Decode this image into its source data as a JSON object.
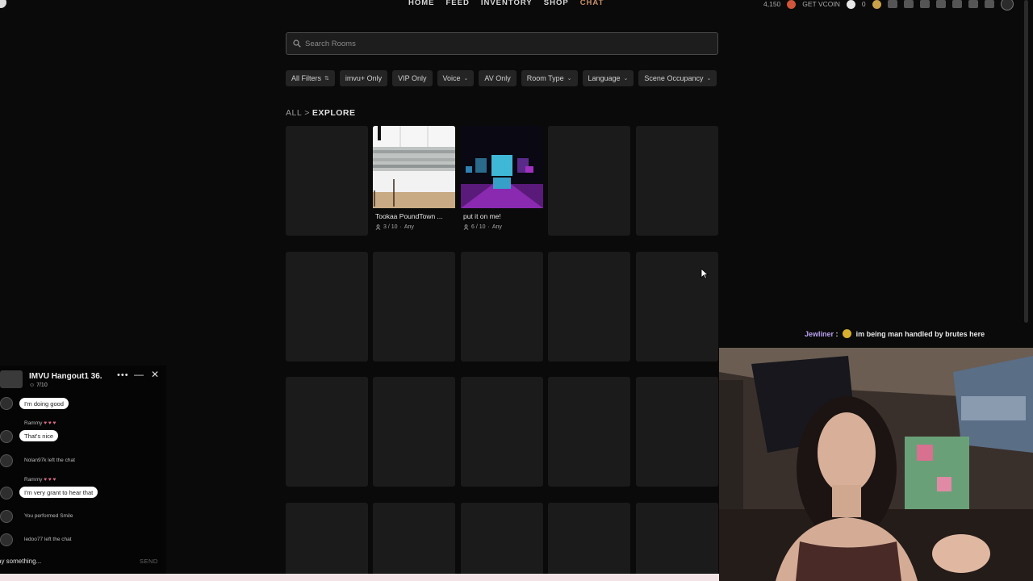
{
  "nav": {
    "links": [
      "HOME",
      "FEED",
      "INVENTORY",
      "SHOP",
      "CHAT"
    ],
    "active": "CHAT",
    "credits": "4,150",
    "get_vcoin": "GET VCOIN",
    "vcoin_balance": "0"
  },
  "search": {
    "placeholder": "Search Rooms"
  },
  "filters": [
    {
      "label": "All Filters",
      "suffix": "⇅"
    },
    {
      "label": "imvu+ Only",
      "suffix": ""
    },
    {
      "label": "VIP Only",
      "suffix": ""
    },
    {
      "label": "Voice",
      "suffix": "⌄"
    },
    {
      "label": "AV Only",
      "suffix": ""
    },
    {
      "label": "Room Type",
      "suffix": "⌄"
    },
    {
      "label": "Language",
      "suffix": "⌄"
    },
    {
      "label": "Scene Occupancy",
      "suffix": "⌄"
    }
  ],
  "breadcrumb": {
    "root": "ALL",
    "separator": ">",
    "current": "EXPLORE"
  },
  "rooms": [
    {
      "title": "Tookaa PoundTown ...",
      "occupancy": "3 / 10",
      "language": "Any"
    },
    {
      "title": "put it on me!",
      "occupancy": "6 / 10",
      "language": "Any"
    }
  ],
  "chat": {
    "room_name": "IMVU Hangout1 36.",
    "occupancy": "7/10",
    "messages": [
      {
        "kind": "bubble",
        "text": "I'm doing good"
      },
      {
        "kind": "sender",
        "text": "Rammy"
      },
      {
        "kind": "bubble",
        "text": "That's nice"
      },
      {
        "kind": "system",
        "text": "Nolan97k left the chat"
      },
      {
        "kind": "sender",
        "text": "Rammy"
      },
      {
        "kind": "bubble",
        "text": "I'm very grant to hear that"
      },
      {
        "kind": "system",
        "text": "You performed Smile"
      },
      {
        "kind": "system",
        "text": "ledoo77 left the chat"
      }
    ],
    "input_placeholder": "ay something...",
    "send_label": "SEND"
  },
  "stream_alert": {
    "user": "Jewliner",
    "sep": ":",
    "message": "im being man handled by brutes here"
  },
  "colors": {
    "active_nav": "#c9906a",
    "background": "#0a0a0a",
    "card": "#1b1b1b"
  }
}
